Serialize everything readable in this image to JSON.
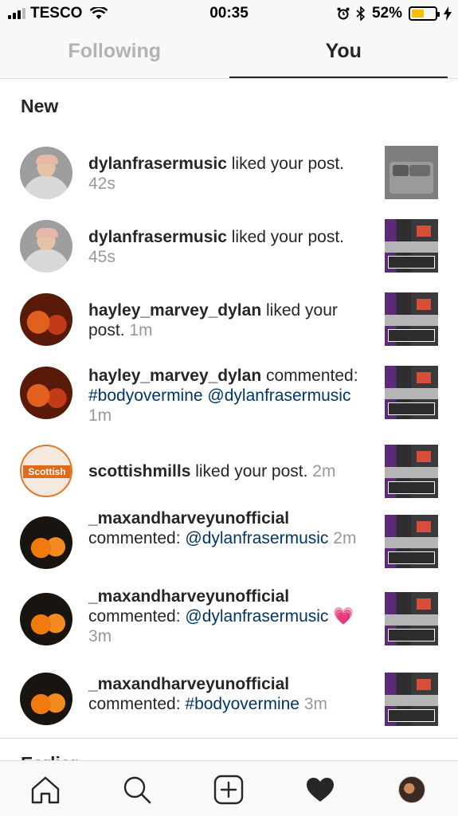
{
  "status_bar": {
    "carrier": "TESCO",
    "time": "00:35",
    "battery_percent": "52%",
    "battery_level": 0.52,
    "battery_color": "#f5c000"
  },
  "tabs": [
    {
      "label": "Following",
      "active": false
    },
    {
      "label": "You",
      "active": true
    }
  ],
  "sections": {
    "new_title": "New",
    "earlier_title": "Earlier"
  },
  "notifications": [
    {
      "user": "dylanfrasermusic",
      "action": " liked your post.",
      "link": "",
      "time": "42s",
      "avatar": "profile-photo",
      "thumb": "control-center"
    },
    {
      "user": "dylanfrasermusic",
      "action": " liked your post.",
      "link": "",
      "time": "45s",
      "avatar": "profile-photo",
      "thumb": "screenshot-post"
    },
    {
      "user": "hayley_marvey_dylan",
      "action": " liked your post.",
      "link": "",
      "time": "1m",
      "avatar": "profile-photo",
      "thumb": "screenshot-post"
    },
    {
      "user": "hayley_marvey_dylan",
      "action": " commented: ",
      "link": "#bodyovermine @dylanfrasermusic",
      "time": "1m",
      "avatar": "profile-photo",
      "thumb": "screenshot-post"
    },
    {
      "user": "scottishmills",
      "action": " liked your post.",
      "link": "",
      "time": "2m",
      "avatar": "scottish-logo",
      "avatar_text": "Scottish",
      "thumb": "screenshot-post"
    },
    {
      "user": "_maxandharveyunofficial",
      "action": " commented: ",
      "link": "@dylanfrasermusic",
      "time": "2m",
      "avatar": "profile-photo",
      "thumb": "screenshot-post"
    },
    {
      "user": "_maxandharveyunofficial",
      "action": " commented: ",
      "link": "@dylanfrasermusic",
      "emoji": "💗",
      "time": "3m",
      "avatar": "profile-photo",
      "thumb": "screenshot-post"
    },
    {
      "user": "_maxandharveyunofficial",
      "action": " commented: ",
      "link": "#bodyovermine",
      "time": "3m",
      "avatar": "profile-photo",
      "thumb": "screenshot-post"
    }
  ],
  "bottom_nav": {
    "icons": [
      "home-icon",
      "search-icon",
      "add-post-icon",
      "activity-heart-icon",
      "profile-avatar"
    ]
  }
}
